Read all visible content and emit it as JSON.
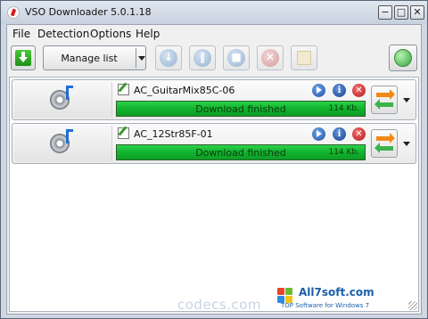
{
  "window": {
    "title": "VSO Downloader 5.0.1.18",
    "controls": {
      "minimize": "−",
      "maximize": "□",
      "close": "✕"
    }
  },
  "menu": [
    "File",
    "Detection",
    "Options",
    "Help"
  ],
  "toolbar": {
    "manage_list_label": "Manage list",
    "buttons": [
      "download-icon",
      "pause-icon",
      "stop-icon",
      "delete-icon",
      "clear-list-icon",
      "globe-icon"
    ],
    "download_glyph": "↓",
    "pause_glyph": "‖",
    "stop_glyph": "■",
    "delete_glyph": "✕"
  },
  "downloads": [
    {
      "name": "AC_GuitarMix85C-06",
      "status": "Download finished",
      "size": "114 Kb.",
      "progress": 1.0
    },
    {
      "name": "AC_12Str85F-01",
      "status": "Download finished",
      "size": "114 Kb.",
      "progress": 1.0
    }
  ],
  "row_icons": {
    "info": "i",
    "stop": "✕"
  },
  "watermark": {
    "site": "codecs.com",
    "brand": "All7soft.com",
    "tagline": "TOP Software for Windows 7"
  },
  "colors": {
    "progress_green": "#12b52f",
    "accent_blue": "#1b5fa8"
  }
}
